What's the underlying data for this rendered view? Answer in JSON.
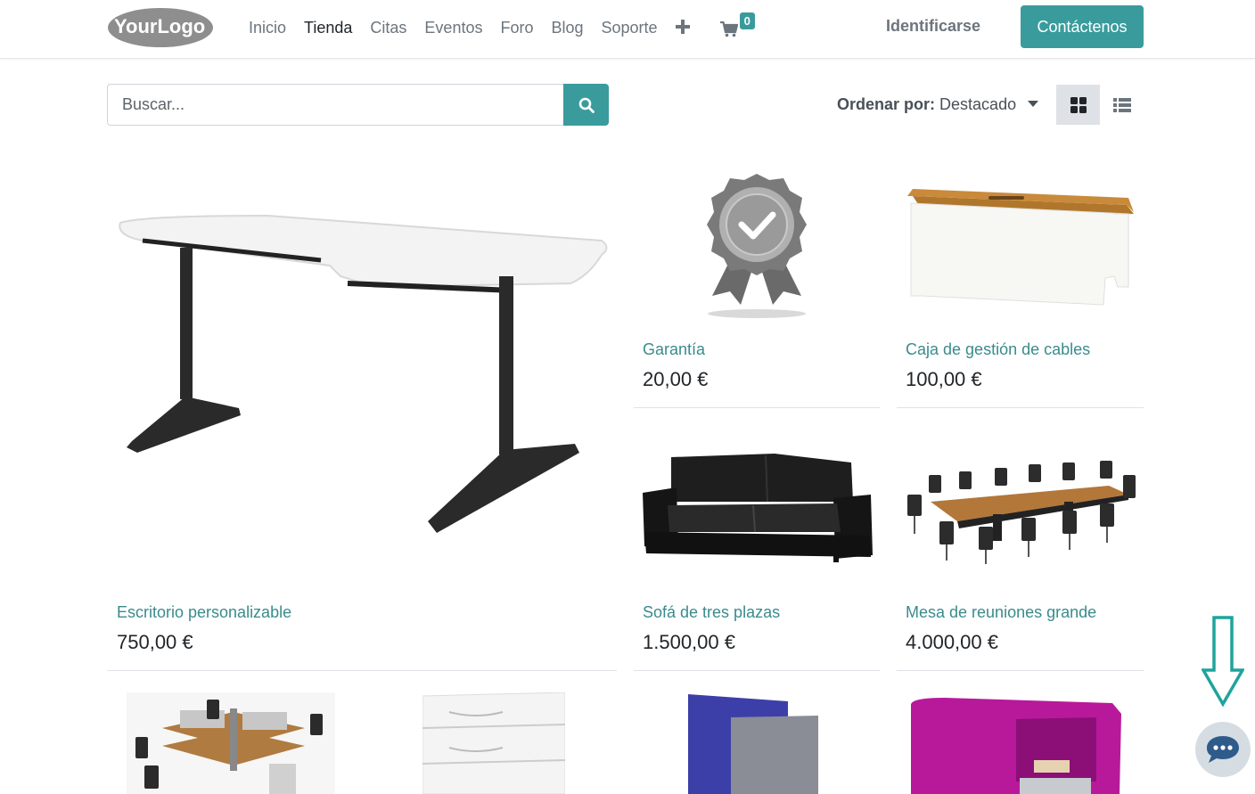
{
  "header": {
    "logo_text": "YourLogo",
    "nav": [
      {
        "label": "Inicio"
      },
      {
        "label": "Tienda"
      },
      {
        "label": "Citas"
      },
      {
        "label": "Eventos"
      },
      {
        "label": "Foro"
      },
      {
        "label": "Blog"
      },
      {
        "label": "Soporte"
      }
    ],
    "cart_count": "0",
    "login_label": "Identificarse",
    "contact_label": "Contáctenos"
  },
  "search": {
    "placeholder": "Buscar..."
  },
  "sort": {
    "label": "Ordenar por:",
    "value": "Destacado"
  },
  "products": [
    {
      "name": "Escritorio personalizable",
      "price": "750,00 €"
    },
    {
      "name": "Garantía",
      "price": "20,00 €"
    },
    {
      "name": "Caja de gestión de cables",
      "price": "100,00 €"
    },
    {
      "name": "Sofá de tres plazas",
      "price": "1.500,00 €"
    },
    {
      "name": "Mesa de reuniones grande",
      "price": "4.000,00 €"
    }
  ],
  "colors": {
    "accent": "#3a9b9d",
    "link": "#3a8b8d",
    "annotation": "#1fa39c"
  },
  "icons": [
    "plus-icon",
    "cart-icon",
    "search-icon",
    "grid-view-icon",
    "list-view-icon",
    "chat-icon",
    "arrow-down-icon"
  ]
}
